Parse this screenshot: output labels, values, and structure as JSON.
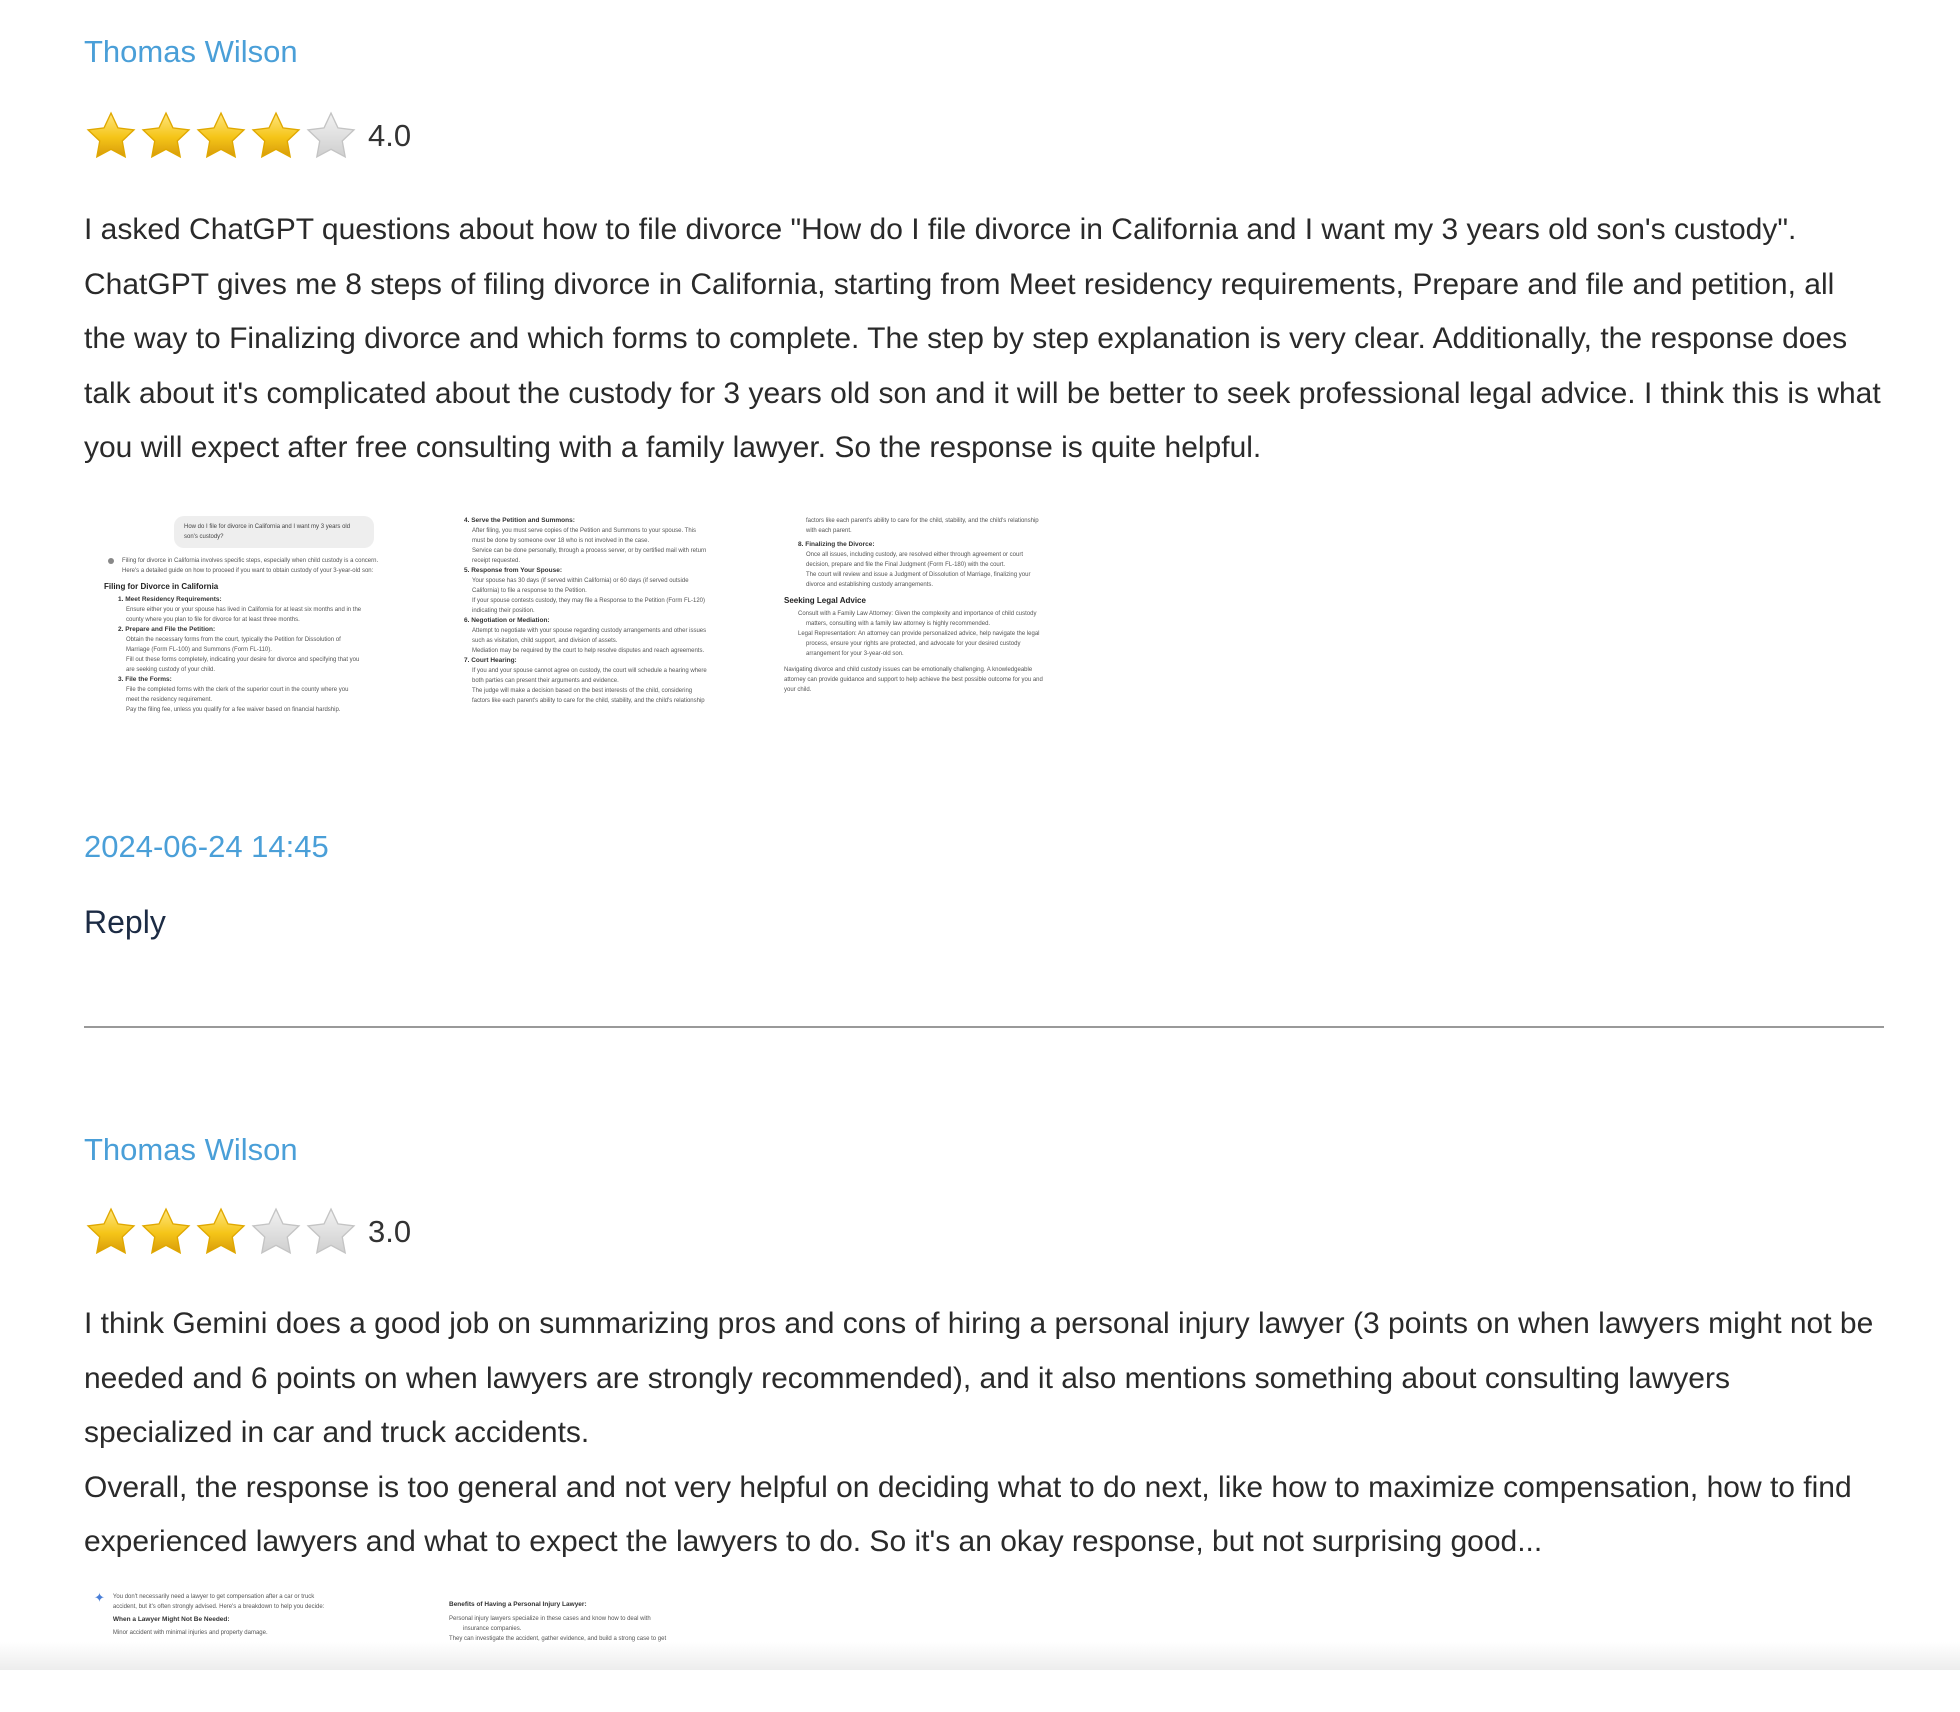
{
  "reviews": [
    {
      "author": "Thomas Wilson",
      "rating": 4.0,
      "rating_label": "4.0",
      "body": "I asked ChatGPT questions about how to file divorce \"How do I file divorce in California and I want my 3 years old son's custody\". ChatGPT gives me 8 steps of filing divorce in California, starting from Meet residency requirements, Prepare and file and petition, all the way to Finalizing divorce and which forms to complete. The step by step explanation is very clear. Additionally, the response does talk about it's complicated about the custody for 3 years old son and it will be better to seek professional legal advice. I think this is what you will expect after free consulting with a family lawyer. So the response is quite helpful.",
      "timestamp": "2024-06-24 14:45",
      "reply_label": "Reply",
      "screenshots": [
        {
          "bubble": "How do I file for divorce in California and I want my 3 years old son's custody?",
          "intro_1": "Filing for divorce in California involves specific steps, especially when child custody is a concern.",
          "intro_2": "Here's a detailed guide on how to proceed if you want to obtain custody of your 3-year-old son:",
          "heading": "Filing for Divorce in California",
          "s1": "1.  Meet Residency Requirements:",
          "s1a": "Ensure either you or your spouse has lived in California for at least six months and in the",
          "s1b": "county where you plan to file for divorce for at least three months.",
          "s2": "2.  Prepare and File the Petition:",
          "s2a": "Obtain the necessary forms from the court, typically the Petition for Dissolution of",
          "s2b": "Marriage (Form FL-100) and Summons (Form FL-110).",
          "s2c": "Fill out these forms completely, indicating your desire for divorce and specifying that you",
          "s2d": "are seeking custody of your child.",
          "s3": "3.  File the Forms:",
          "s3a": "File the completed forms with the clerk of the superior court in the county where you",
          "s3b": "meet the residency requirement.",
          "s3c": "Pay the filing fee, unless you qualify for a fee waiver based on financial hardship."
        },
        {
          "s4": "4.  Serve the Petition and Summons:",
          "s4a": "After filing, you must serve copies of the Petition and Summons to your spouse. This",
          "s4b": "must be done by someone over 18 who is not involved in the case.",
          "s4c": "Service can be done personally, through a process server, or by certified mail with return",
          "s4d": "receipt requested.",
          "s5": "5.  Response from Your Spouse:",
          "s5a": "Your spouse has 30 days (if served within California) or 60 days (if served outside",
          "s5b": "California) to file a response to the Petition.",
          "s5c": "If your spouse contests custody, they may file a Response to the Petition (Form FL-120)",
          "s5d": "indicating their position.",
          "s6": "6.  Negotiation or Mediation:",
          "s6a": "Attempt to negotiate with your spouse regarding custody arrangements and other issues",
          "s6b": "such as visitation, child support, and division of assets.",
          "s6c": "Mediation may be required by the court to help resolve disputes and reach agreements.",
          "s7": "7.  Court Hearing:",
          "s7a": "If you and your spouse cannot agree on custody, the court will schedule a hearing where",
          "s7b": "both parties can present their arguments and evidence.",
          "s7c": "The judge will make a decision based on the best interests of the child, considering",
          "s7d": "factors like each parent's ability to care for the child, stability, and the child's relationship"
        },
        {
          "t1": "factors like each parent's ability to care for the child, stability, and the child's relationship",
          "t2": "with each parent.",
          "s8": "8.  Finalizing the Divorce:",
          "s8a": "Once all issues, including custody, are resolved either through agreement or court",
          "s8b": "decision, prepare and file the Final Judgment (Form FL-180) with the court.",
          "s8c": "The court will review and issue a Judgment of Dissolution of Marriage, finalizing your",
          "s8d": "divorce and establishing custody arrangements.",
          "heading": "Seeking Legal Advice",
          "b1": "Consult with a Family Law Attorney: Given the complexity and importance of child custody",
          "b1b": "matters, consulting with a family law attorney is highly recommended.",
          "b2": "Legal Representation: An attorney can provide personalized advice, help navigate the legal",
          "b2b": "process, ensure your rights are protected, and advocate for your desired custody",
          "b2c": "arrangement for your 3-year-old son.",
          "c1": "Navigating divorce and child custody issues can be emotionally challenging. A knowledgeable",
          "c2": "attorney can provide guidance and support to help achieve the best possible outcome for you and",
          "c3": "your child."
        }
      ]
    },
    {
      "author": "Thomas Wilson",
      "rating": 3.0,
      "rating_label": "3.0",
      "body": "I think Gemini does a good job on summarizing pros and cons of hiring a personal injury lawyer (3 points on when lawyers might not be needed and 6 points on when lawyers are strongly recommended), and it also mentions something about consulting lawyers specialized in car and truck accidents.\nOverall, the response is too general and not very helpful on deciding what to do next, like how to maximize compensation, how to find experienced lawyers and what to expect the lawyers to do. So it's an okay response, but not surprising good...",
      "screenshots": [
        {
          "l1": "You don't necessarily need a lawyer to get compensation after a car or truck",
          "l2": "accident, but it's often strongly advised. Here's a breakdown to help you decide:",
          "heading": "When a Lawyer Might Not Be Needed:",
          "b1": "Minor accident with minimal injuries and property damage."
        },
        {
          "heading": "Benefits of Having a Personal Injury Lawyer:",
          "b1": "Personal injury lawyers specialize in these cases and know how to deal with",
          "b1b": "insurance companies.",
          "b2": "They can investigate the accident, gather evidence, and build a strong case to get"
        }
      ]
    }
  ],
  "colors": {
    "link": "#4a9fd8",
    "star_filled": "#f5c518",
    "star_empty": "#d6d6d6",
    "text": "#2a2a2a",
    "reply": "#1c2b44"
  }
}
